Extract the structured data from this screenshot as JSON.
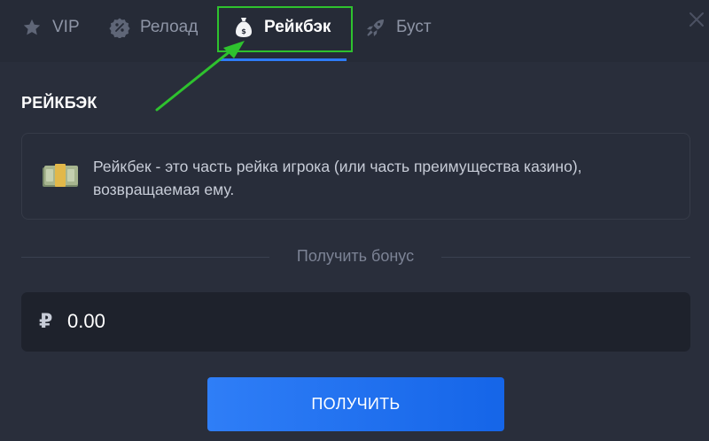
{
  "tabs": [
    {
      "label": "VIP",
      "icon": "star-icon"
    },
    {
      "label": "Релоад",
      "icon": "percent-badge-icon"
    },
    {
      "label": "Рейкбэк",
      "icon": "money-bag-icon",
      "active": true
    },
    {
      "label": "Буст",
      "icon": "rocket-icon"
    }
  ],
  "section": {
    "title": "РЕЙКБЭК",
    "description": "Рейкбек - это часть рейка игрока (или часть преимущества казино), возвращаемая ему.",
    "icon": "money-stack-icon"
  },
  "divider_label": "Получить бонус",
  "amount": {
    "currency_symbol": "₽",
    "value": "0.00"
  },
  "claim_button": {
    "label": "ПОЛУЧИТЬ"
  },
  "colors": {
    "background": "#292e3b",
    "tabbar": "#262b37",
    "accent": "#2e7bf6",
    "annotation": "#2ec22e"
  }
}
